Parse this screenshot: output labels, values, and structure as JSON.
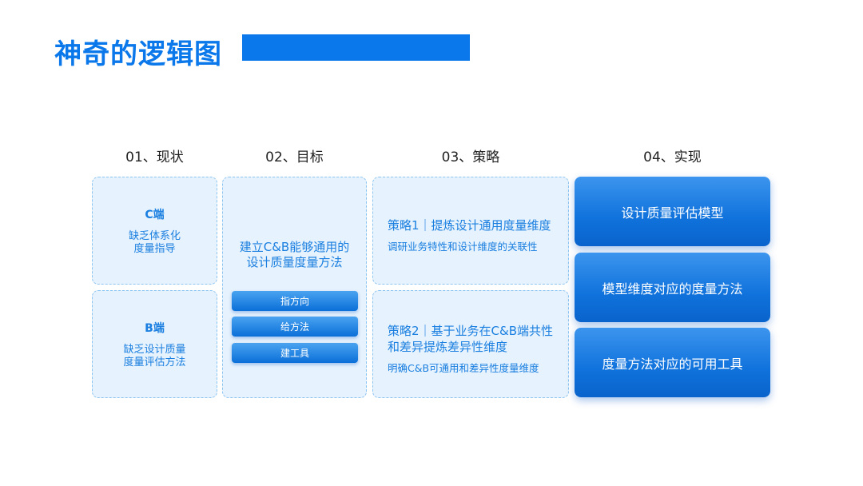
{
  "title": "神奇的逻辑图",
  "columns": [
    {
      "heading": "01、现状"
    },
    {
      "heading": "02、目标"
    },
    {
      "heading": "03、策略"
    },
    {
      "heading": "04、实现"
    }
  ],
  "status": [
    {
      "name": "C端",
      "line1": "缺乏体系化",
      "line2": "度量指导"
    },
    {
      "name": "B端",
      "line1": "缺乏设计质量",
      "line2": "度量评估方法"
    }
  ],
  "goal": {
    "line1": "建立C&B能够通用的",
    "line2": "设计质量度量方法",
    "pills": [
      "指方向",
      "给方法",
      "建工具"
    ]
  },
  "strategies": [
    {
      "title_line1": "策略1｜提炼设计通用度量维度",
      "title_line2": "",
      "sub": "调研业务特性和设计维度的关联性"
    },
    {
      "title_line1": "策略2｜基于业务在C&B端共性",
      "title_line2": "和差异提炼差异性维度",
      "sub": "明确C&B可通用和差异性度量维度"
    }
  ],
  "implementation": [
    "设计质量评估模型",
    "模型维度对应的度量方法",
    "度量方法对应的可用工具"
  ],
  "colors": {
    "accent": "#0a78ea",
    "box_fill": "#e6f2fd",
    "box_border": "#8cc4f2"
  }
}
